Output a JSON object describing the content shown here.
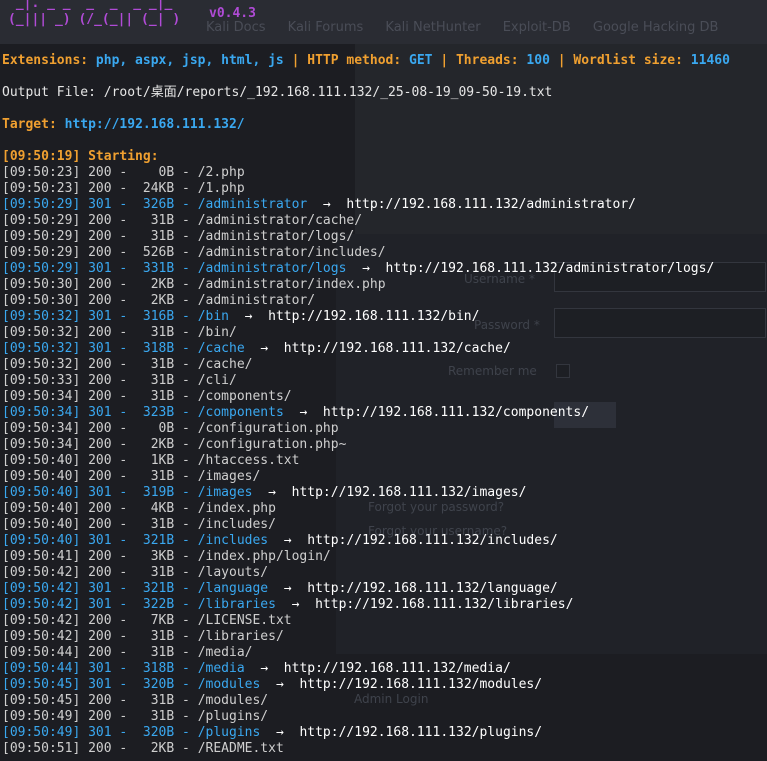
{
  "logo": {
    "art_line1": " _|. _ _  _  _  _ _|_",
    "art_line2": "(_||| _) (/_(_|| (_| )",
    "version": "v0.4.3"
  },
  "background": {
    "bookmarks": [
      "Kali Docs",
      "Kali Forums",
      "Kali NetHunter",
      "Exploit-DB",
      "Google Hacking DB"
    ],
    "form_labels": [
      "Username *",
      "Password *",
      "Remember me",
      "Forgot your password?",
      "Forgot your username?",
      "Admin Login"
    ]
  },
  "header": {
    "extensions_label": "Extensions:",
    "extensions_value": "php, aspx, jsp, html, js",
    "method_label": "HTTP method:",
    "method_value": "GET",
    "threads_label": "Threads:",
    "threads_value": "100",
    "wordlist_label": "Wordlist size:",
    "wordlist_value": "11460",
    "separator": "|"
  },
  "output_file": "Output File: /root/桌面/reports/_192.168.111.132/_25-08-19_09-50-19.txt",
  "target_label": "Target:",
  "target_value": "http://192.168.111.132/",
  "starting": "[09:50:19] Starting:",
  "results": [
    {
      "time": "[09:50:23]",
      "status": "200",
      "size": "0B",
      "path": "/2.php",
      "redirect": ""
    },
    {
      "time": "[09:50:23]",
      "status": "200",
      "size": "24KB",
      "path": "/1.php",
      "redirect": ""
    },
    {
      "time": "[09:50:29]",
      "status": "301",
      "size": "326B",
      "path": "/administrator",
      "redirect": "http://192.168.111.132/administrator/"
    },
    {
      "time": "[09:50:29]",
      "status": "200",
      "size": "31B",
      "path": "/administrator/cache/",
      "redirect": ""
    },
    {
      "time": "[09:50:29]",
      "status": "200",
      "size": "31B",
      "path": "/administrator/logs/",
      "redirect": ""
    },
    {
      "time": "[09:50:29]",
      "status": "200",
      "size": "526B",
      "path": "/administrator/includes/",
      "redirect": ""
    },
    {
      "time": "[09:50:29]",
      "status": "301",
      "size": "331B",
      "path": "/administrator/logs",
      "redirect": "http://192.168.111.132/administrator/logs/"
    },
    {
      "time": "[09:50:30]",
      "status": "200",
      "size": "2KB",
      "path": "/administrator/index.php",
      "redirect": ""
    },
    {
      "time": "[09:50:30]",
      "status": "200",
      "size": "2KB",
      "path": "/administrator/",
      "redirect": ""
    },
    {
      "time": "[09:50:32]",
      "status": "301",
      "size": "316B",
      "path": "/bin",
      "redirect": "http://192.168.111.132/bin/"
    },
    {
      "time": "[09:50:32]",
      "status": "200",
      "size": "31B",
      "path": "/bin/",
      "redirect": ""
    },
    {
      "time": "[09:50:32]",
      "status": "301",
      "size": "318B",
      "path": "/cache",
      "redirect": "http://192.168.111.132/cache/"
    },
    {
      "time": "[09:50:32]",
      "status": "200",
      "size": "31B",
      "path": "/cache/",
      "redirect": ""
    },
    {
      "time": "[09:50:33]",
      "status": "200",
      "size": "31B",
      "path": "/cli/",
      "redirect": ""
    },
    {
      "time": "[09:50:34]",
      "status": "200",
      "size": "31B",
      "path": "/components/",
      "redirect": ""
    },
    {
      "time": "[09:50:34]",
      "status": "301",
      "size": "323B",
      "path": "/components",
      "redirect": "http://192.168.111.132/components/"
    },
    {
      "time": "[09:50:34]",
      "status": "200",
      "size": "0B",
      "path": "/configuration.php",
      "redirect": ""
    },
    {
      "time": "[09:50:34]",
      "status": "200",
      "size": "2KB",
      "path": "/configuration.php~",
      "redirect": ""
    },
    {
      "time": "[09:50:40]",
      "status": "200",
      "size": "1KB",
      "path": "/htaccess.txt",
      "redirect": ""
    },
    {
      "time": "[09:50:40]",
      "status": "200",
      "size": "31B",
      "path": "/images/",
      "redirect": ""
    },
    {
      "time": "[09:50:40]",
      "status": "301",
      "size": "319B",
      "path": "/images",
      "redirect": "http://192.168.111.132/images/"
    },
    {
      "time": "[09:50:40]",
      "status": "200",
      "size": "4KB",
      "path": "/index.php",
      "redirect": ""
    },
    {
      "time": "[09:50:40]",
      "status": "200",
      "size": "31B",
      "path": "/includes/",
      "redirect": ""
    },
    {
      "time": "[09:50:40]",
      "status": "301",
      "size": "321B",
      "path": "/includes",
      "redirect": "http://192.168.111.132/includes/"
    },
    {
      "time": "[09:50:41]",
      "status": "200",
      "size": "3KB",
      "path": "/index.php/login/",
      "redirect": ""
    },
    {
      "time": "[09:50:42]",
      "status": "200",
      "size": "31B",
      "path": "/layouts/",
      "redirect": ""
    },
    {
      "time": "[09:50:42]",
      "status": "301",
      "size": "321B",
      "path": "/language",
      "redirect": "http://192.168.111.132/language/"
    },
    {
      "time": "[09:50:42]",
      "status": "301",
      "size": "322B",
      "path": "/libraries",
      "redirect": "http://192.168.111.132/libraries/"
    },
    {
      "time": "[09:50:42]",
      "status": "200",
      "size": "7KB",
      "path": "/LICENSE.txt",
      "redirect": ""
    },
    {
      "time": "[09:50:42]",
      "status": "200",
      "size": "31B",
      "path": "/libraries/",
      "redirect": ""
    },
    {
      "time": "[09:50:44]",
      "status": "200",
      "size": "31B",
      "path": "/media/",
      "redirect": ""
    },
    {
      "time": "[09:50:44]",
      "status": "301",
      "size": "318B",
      "path": "/media",
      "redirect": "http://192.168.111.132/media/"
    },
    {
      "time": "[09:50:45]",
      "status": "301",
      "size": "320B",
      "path": "/modules",
      "redirect": "http://192.168.111.132/modules/"
    },
    {
      "time": "[09:50:45]",
      "status": "200",
      "size": "31B",
      "path": "/modules/",
      "redirect": ""
    },
    {
      "time": "[09:50:49]",
      "status": "200",
      "size": "31B",
      "path": "/plugins/",
      "redirect": ""
    },
    {
      "time": "[09:50:49]",
      "status": "301",
      "size": "320B",
      "path": "/plugins",
      "redirect": "http://192.168.111.132/plugins/"
    },
    {
      "time": "[09:50:51]",
      "status": "200",
      "size": "2KB",
      "path": "/README.txt",
      "redirect": ""
    }
  ],
  "colors": {
    "accent_orange": "#f0a030",
    "accent_blue": "#3aa8f0",
    "logo_purple": "#b04bd6",
    "background": "#1c1d22"
  }
}
